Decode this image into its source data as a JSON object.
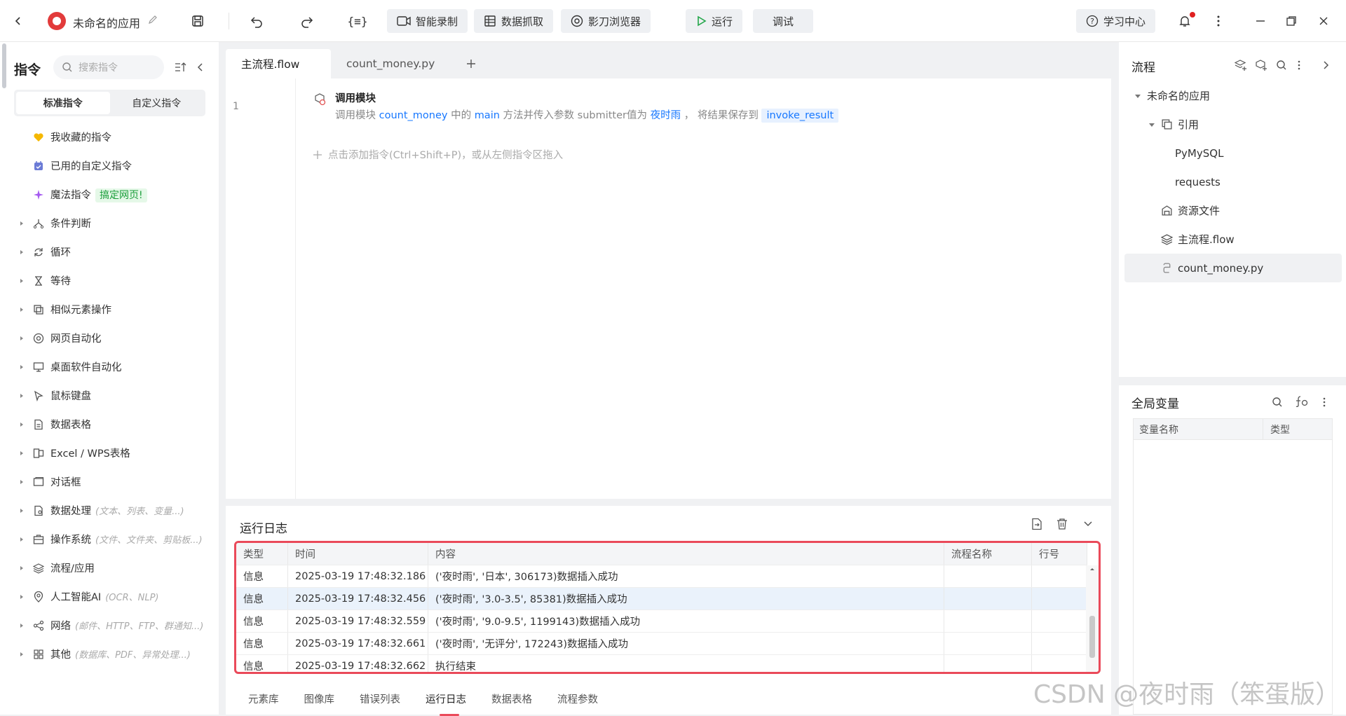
{
  "titlebar": {
    "app_name": "未命名的应用",
    "record": "智能录制",
    "capture": "数据抓取",
    "browser": "影刀浏览器",
    "run": "运行",
    "debug": "调试",
    "learn": "学习中心"
  },
  "left": {
    "title": "指令",
    "search_placeholder": "搜索指令",
    "seg_standard": "标准指令",
    "seg_custom": "自定义指令",
    "items": [
      {
        "label": "我收藏的指令",
        "hint": "",
        "badge": ""
      },
      {
        "label": "已用的自定义指令",
        "hint": "",
        "badge": ""
      },
      {
        "label": "魔法指令",
        "hint": "",
        "badge": "搞定网页!"
      },
      {
        "label": "条件判断",
        "hint": "",
        "badge": ""
      },
      {
        "label": "循环",
        "hint": "",
        "badge": ""
      },
      {
        "label": "等待",
        "hint": "",
        "badge": ""
      },
      {
        "label": "相似元素操作",
        "hint": "",
        "badge": ""
      },
      {
        "label": "网页自动化",
        "hint": "",
        "badge": ""
      },
      {
        "label": "桌面软件自动化",
        "hint": "",
        "badge": ""
      },
      {
        "label": "鼠标键盘",
        "hint": "",
        "badge": ""
      },
      {
        "label": "数据表格",
        "hint": "",
        "badge": ""
      },
      {
        "label": "Excel / WPS表格",
        "hint": "",
        "badge": ""
      },
      {
        "label": "对话框",
        "hint": "",
        "badge": ""
      },
      {
        "label": "数据处理",
        "hint": "(文本、列表、变量...)",
        "badge": ""
      },
      {
        "label": "操作系统",
        "hint": "(文件、文件夹、剪贴板...)",
        "badge": ""
      },
      {
        "label": "流程/应用",
        "hint": "",
        "badge": ""
      },
      {
        "label": "人工智能AI",
        "hint": "(OCR、NLP)",
        "badge": ""
      },
      {
        "label": "网络",
        "hint": "(邮件、HTTP、FTP、群通知...)",
        "badge": ""
      },
      {
        "label": "其他",
        "hint": "(数据库、PDF、异常处理...)",
        "badge": ""
      }
    ]
  },
  "editor": {
    "tabs": [
      "主流程.flow",
      "count_money.py"
    ],
    "line_no": "1",
    "cmd_title": "调用模块",
    "cmd_desc": {
      "p1": "调用模块",
      "module": "count_money",
      "p2": "中的",
      "method": "main",
      "p3": "方法并传入参数 submitter值为",
      "arg": "夜时雨",
      "p4": "，  将结果保存到",
      "result": "invoke_result"
    },
    "add_hint": "点击添加指令(Ctrl+Shift+P)，或从左侧指令区拖入"
  },
  "log": {
    "title": "运行日志",
    "columns": [
      "类型",
      "时间",
      "内容",
      "流程名称",
      "行号"
    ],
    "rows": [
      {
        "type": "信息",
        "time": "2025-03-19 17:48:32.186",
        "content": "('夜时雨', '日本', 306173)数据插入成功",
        "flow": "",
        "line": ""
      },
      {
        "type": "信息",
        "time": "2025-03-19 17:48:32.456",
        "content": "('夜时雨', '3.0-3.5', 85381)数据插入成功",
        "flow": "",
        "line": ""
      },
      {
        "type": "信息",
        "time": "2025-03-19 17:48:32.559",
        "content": "('夜时雨', '9.0-9.5', 1199143)数据插入成功",
        "flow": "",
        "line": ""
      },
      {
        "type": "信息",
        "time": "2025-03-19 17:48:32.661",
        "content": "('夜时雨', '无评分', 172243)数据插入成功",
        "flow": "",
        "line": ""
      },
      {
        "type": "信息",
        "time": "2025-03-19 17:48:32.662",
        "content": "执行结束",
        "flow": "",
        "line": ""
      }
    ],
    "bottom_tabs": [
      "元素库",
      "图像库",
      "错误列表",
      "运行日志",
      "数据表格",
      "流程参数"
    ]
  },
  "right": {
    "title": "流程",
    "tree": {
      "app": "未命名的应用",
      "ref": "引用",
      "pymysql": "PyMySQL",
      "requests": "requests",
      "resources": "资源文件",
      "main_flow": "主流程.flow",
      "module": "count_money.py"
    },
    "vars_title": "全局变量",
    "var_cols": [
      "变量名称",
      "类型"
    ]
  },
  "watermark": "CSDN @夜时雨（笨蛋版）",
  "colors": {
    "accent": "#1677ff",
    "run_green": "#22a649",
    "highlight_border": "#ea4a5a"
  }
}
